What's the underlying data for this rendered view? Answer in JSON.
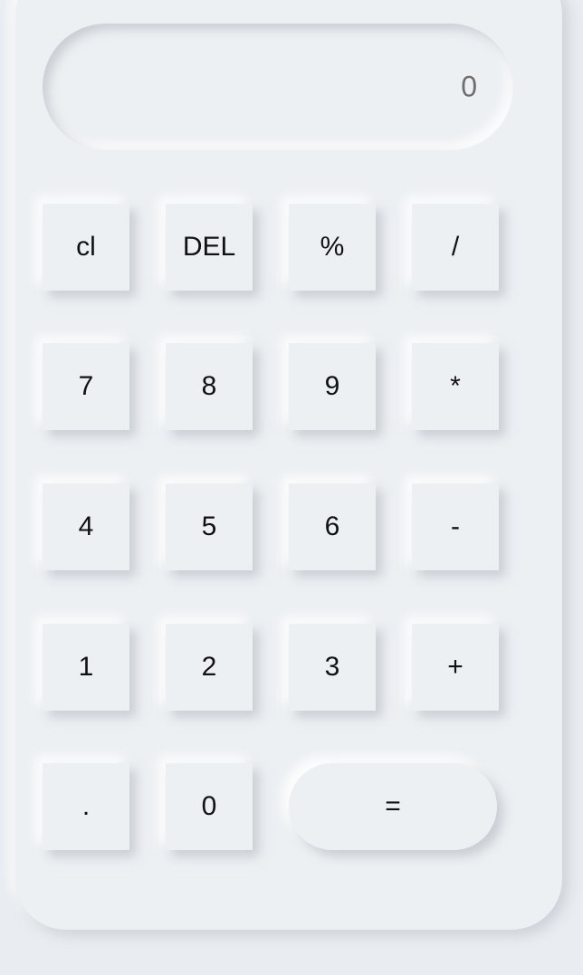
{
  "display": {
    "value": "0"
  },
  "keys": {
    "clear": "cl",
    "delete": "DEL",
    "percent": "%",
    "divide": "/",
    "seven": "7",
    "eight": "8",
    "nine": "9",
    "multiply": "*",
    "four": "4",
    "five": "5",
    "six": "6",
    "subtract": "-",
    "one": "1",
    "two": "2",
    "three": "3",
    "add": "+",
    "decimal": ".",
    "zero": "0",
    "equals": "="
  }
}
